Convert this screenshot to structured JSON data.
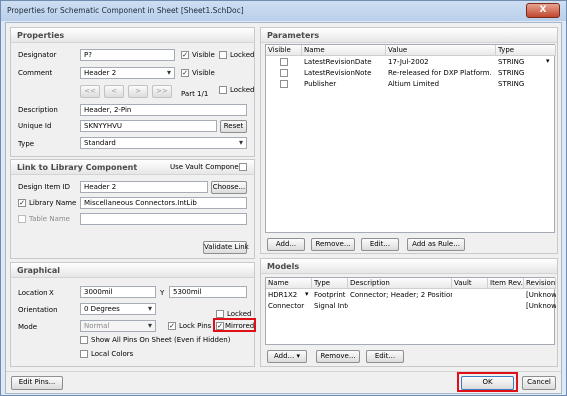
{
  "window": {
    "title": "Properties for Schematic Component in Sheet [Sheet1.SchDoc]",
    "close": "X"
  },
  "properties": {
    "heading": "Properties",
    "designator_label": "Designator",
    "designator_value": "P?",
    "visible_label": "Visible",
    "locked_label": "Locked",
    "comment_label": "Comment",
    "comment_value": "Header 2",
    "comment_visible_label": "Visible",
    "nav": [
      "<<",
      "<",
      ">",
      ">>"
    ],
    "part_label": "Part 1/1",
    "part_locked_label": "Locked",
    "description_label": "Description",
    "description_value": "Header, 2-Pin",
    "uniqueid_label": "Unique Id",
    "uniqueid_value": "SKNYYHVU",
    "reset_label": "Reset",
    "type_label": "Type",
    "type_value": "Standard"
  },
  "link": {
    "heading": "Link to Library Component",
    "vault_label": "Use Vault Component",
    "design_item_label": "Design Item ID",
    "design_item_value": "Header 2",
    "choose_label": "Choose...",
    "library_name_label": "Library Name",
    "library_name_value": "Miscellaneous Connectors.IntLib",
    "table_name_label": "Table Name",
    "validate_label": "Validate Link"
  },
  "graphical": {
    "heading": "Graphical",
    "location_label": "Location",
    "x_label": "X",
    "x_value": "3000mil",
    "y_label": "Y",
    "y_value": "5300mil",
    "orientation_label": "Orientation",
    "orientation_value": "0 Degrees",
    "locked_label": "Locked",
    "mode_label": "Mode",
    "mode_value": "Normal",
    "lock_pins_label": "Lock Pins",
    "mirrored_label": "Mirrored",
    "show_all_pins_label": "Show All Pins On Sheet (Even if Hidden)",
    "local_colors_label": "Local Colors"
  },
  "parameters": {
    "heading": "Parameters",
    "columns": [
      "Visible",
      "Name",
      "Value",
      "Type"
    ],
    "rows": [
      {
        "name": "LatestRevisionDate",
        "value": "17-Jul-2002",
        "type": "STRING"
      },
      {
        "name": "LatestRevisionNote",
        "value": "Re-released for DXP Platform.",
        "type": "STRING"
      },
      {
        "name": "Publisher",
        "value": "Altium Limited",
        "type": "STRING"
      }
    ],
    "add_label": "Add...",
    "remove_label": "Remove...",
    "edit_label": "Edit...",
    "add_rule_label": "Add as Rule..."
  },
  "models": {
    "heading": "Models",
    "columns": [
      "Name",
      "Type",
      "Description",
      "Vault",
      "Item Rev...",
      "Revision..."
    ],
    "rows": [
      {
        "name": "HDR1X2",
        "type": "Footprint",
        "description": "Connector; Header; 2 Position",
        "vault": "",
        "item_rev": "",
        "revision": "[Unknown"
      },
      {
        "name": "Connector",
        "type": "Signal Inte",
        "description": "",
        "vault": "",
        "item_rev": "",
        "revision": "[Unknown"
      }
    ],
    "add_label": "Add...",
    "remove_label": "Remove...",
    "edit_label": "Edit..."
  },
  "footer": {
    "edit_pins_label": "Edit Pins...",
    "ok_label": "OK",
    "cancel_label": "Cancel"
  }
}
